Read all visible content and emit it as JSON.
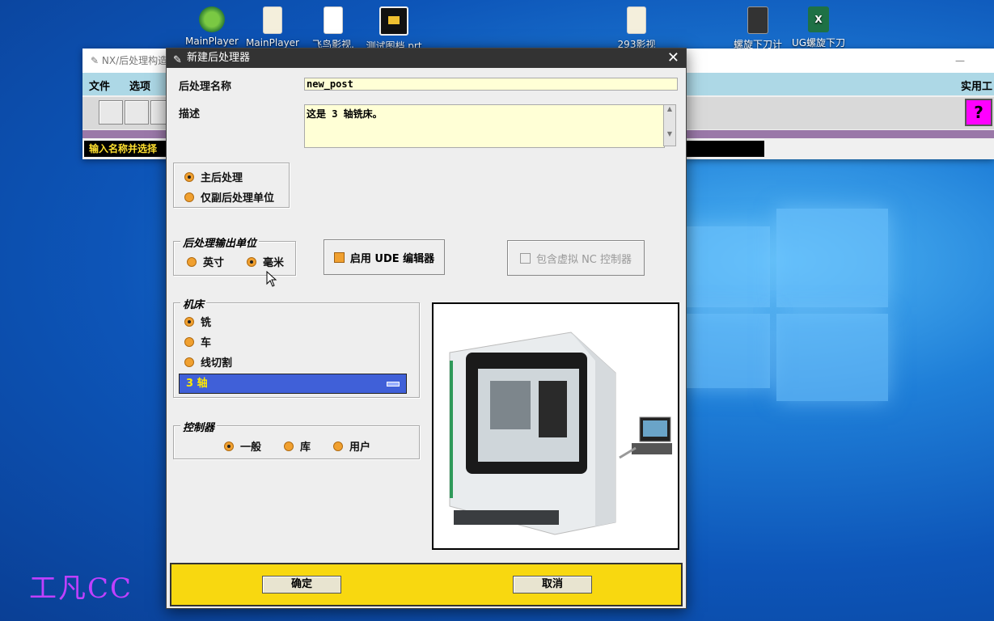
{
  "desktop": {
    "icons": [
      {
        "label": "MainPlayer",
        "icon": "mainplayer-icon"
      },
      {
        "label": "MainPlayer",
        "icon": "file-icon"
      },
      {
        "label": "飞鸟影视.",
        "icon": "file-icon"
      },
      {
        "label": "测试图档.prt",
        "icon": "nx-part-icon"
      },
      {
        "label": "293影视",
        "icon": "file-icon"
      },
      {
        "label": "螺旋下刀计",
        "icon": "calculator-icon"
      },
      {
        "label": "UG螺旋下刀",
        "icon": "excel-icon"
      }
    ],
    "watermark": "工凡CC"
  },
  "bg_app": {
    "title": "NX/后处理构造",
    "menu": [
      "文件",
      "选项"
    ],
    "menu_right": "实用工",
    "status": "输入名称并选择"
  },
  "dialog": {
    "title": "新建后处理器",
    "name_label": "后处理名称",
    "name_value": "new_post",
    "desc_label": "描述",
    "desc_value": "这是 3 轴铣床。",
    "post_type": {
      "main": "主后处理",
      "sub": "仅副后处理单位"
    },
    "units_group": {
      "title": "后处理输出单位",
      "inch": "英寸",
      "mm": "毫米"
    },
    "ude_label": "启用 UDE 编辑器",
    "vnc_label": "包含虚拟 NC 控制器",
    "machine_group": {
      "title": "机床",
      "mill": "铣",
      "lathe": "车",
      "wedm": "线切割",
      "axis": "3 轴"
    },
    "controller_group": {
      "title": "控制器",
      "generic": "一般",
      "library": "库",
      "user": "用户"
    },
    "ok": "确定",
    "cancel": "取消"
  },
  "colors": {
    "dialog_bg": "#eeeeee",
    "field_bg": "#ffffd6",
    "radio_orange": "#f0a030",
    "button_bar": "#f8d810",
    "select_blue": "#4060d8"
  }
}
